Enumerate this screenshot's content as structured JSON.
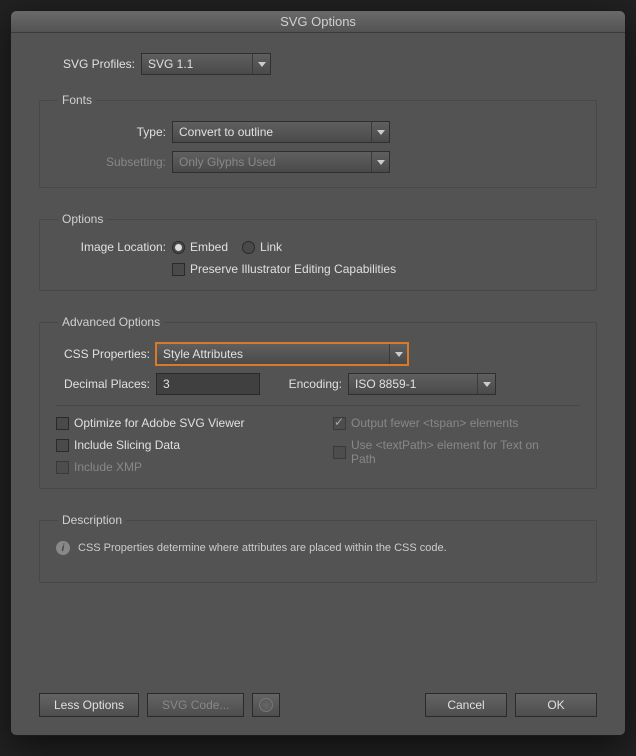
{
  "title": "SVG Options",
  "profiles": {
    "label": "SVG Profiles:",
    "value": "SVG 1.1"
  },
  "fonts": {
    "legend": "Fonts",
    "type": {
      "label": "Type:",
      "value": "Convert to outline"
    },
    "subsetting": {
      "label": "Subsetting:",
      "value": "Only Glyphs Used"
    }
  },
  "options": {
    "legend": "Options",
    "imageLocation": {
      "label": "Image Location:",
      "embed": "Embed",
      "link": "Link"
    },
    "preserve": "Preserve Illustrator Editing Capabilities"
  },
  "advanced": {
    "legend": "Advanced Options",
    "css": {
      "label": "CSS Properties:",
      "value": "Style Attributes"
    },
    "decimal": {
      "label": "Decimal Places:",
      "value": "3"
    },
    "encoding": {
      "label": "Encoding:",
      "value": "ISO 8859-1"
    },
    "optimize": "Optimize for Adobe SVG Viewer",
    "outputFewer": "Output fewer <tspan> elements",
    "includeSlicing": "Include Slicing Data",
    "useTextPath": "Use <textPath> element for Text on Path",
    "includeXMP": "Include XMP"
  },
  "description": {
    "legend": "Description",
    "text": "CSS Properties determine where attributes are placed within the CSS code."
  },
  "footer": {
    "lessOptions": "Less Options",
    "svgCode": "SVG Code...",
    "cancel": "Cancel",
    "ok": "OK"
  }
}
